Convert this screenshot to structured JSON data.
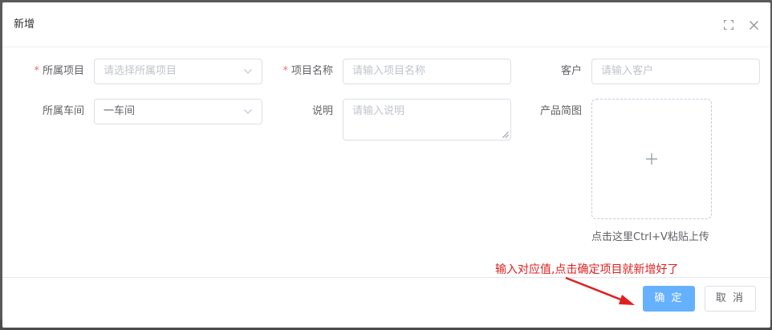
{
  "dialog": {
    "title": "新增",
    "maximize_icon": "fullscreen-icon",
    "close_icon": "close-icon"
  },
  "form": {
    "project": {
      "required_mark": "*",
      "label": "所属项目",
      "placeholder": "请选择所属项目"
    },
    "project_name": {
      "required_mark": "*",
      "label": "项目名称",
      "placeholder": "请输入项目名称"
    },
    "customer": {
      "label": "客户",
      "placeholder": "请输入客户"
    },
    "workshop": {
      "label": "所属车间",
      "value": "一车间"
    },
    "description": {
      "label": "说明",
      "placeholder": "请输入说明"
    },
    "product_image": {
      "label": "产品简图",
      "upload_icon": "plus-icon",
      "tip": "点击这里Ctrl+V粘贴上传"
    }
  },
  "annotation": {
    "text": "输入对应值,点击确定项目就新增好了",
    "color": "#e02020"
  },
  "footer": {
    "confirm_label": "确 定",
    "cancel_label": "取 消"
  },
  "colors": {
    "primary": "#66b1ff",
    "required": "#f56c6c"
  }
}
